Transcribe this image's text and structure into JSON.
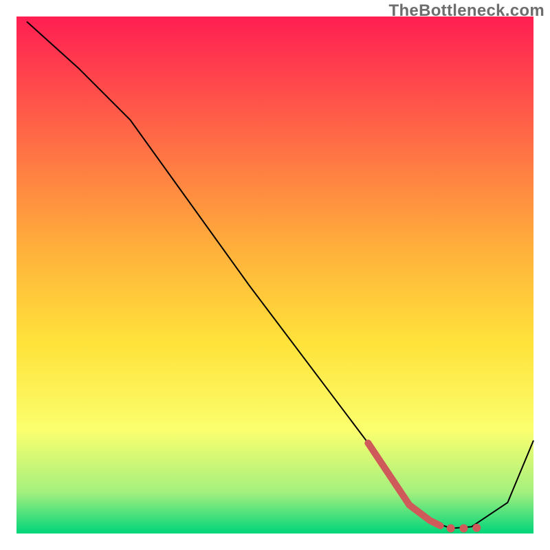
{
  "watermark": "TheBottleneck.com",
  "chart_data": {
    "type": "line",
    "title": "",
    "xlabel": "",
    "ylabel": "",
    "xlim": [
      0,
      100
    ],
    "ylim": [
      0,
      100
    ],
    "background_gradient": {
      "top_color": "#ff1e52",
      "mid_color": "#ffe23a",
      "bottom_color": "#00d47a",
      "stops": [
        {
          "offset": 0.0,
          "color": "#ff1e52"
        },
        {
          "offset": 0.45,
          "color": "#ffb03b"
        },
        {
          "offset": 0.63,
          "color": "#ffe23a"
        },
        {
          "offset": 0.8,
          "color": "#fbff6e"
        },
        {
          "offset": 0.92,
          "color": "#a4f07e"
        },
        {
          "offset": 1.0,
          "color": "#00d47a"
        }
      ]
    },
    "series": [
      {
        "name": "bottleneck-curve",
        "color": "#000000",
        "stroke_width": 2,
        "x": [
          2,
          12,
          22,
          45,
          68,
          76,
          80,
          84,
          88,
          95,
          100
        ],
        "values": [
          99,
          90,
          80,
          48,
          17.5,
          5.5,
          2.5,
          1,
          1.3,
          6,
          18
        ]
      },
      {
        "name": "highlight-segment",
        "color": "#cf5a5a",
        "stroke_width": 10,
        "stroke_linecap": "round",
        "x": [
          68,
          76,
          80,
          82
        ],
        "values": [
          17.5,
          5.5,
          2.5,
          1.5
        ]
      },
      {
        "name": "highlight-dots",
        "color": "#cf5a5a",
        "marker_radius": 6,
        "x": [
          84,
          86.5,
          89
        ],
        "values": [
          1.0,
          1.0,
          1.1
        ]
      }
    ]
  }
}
